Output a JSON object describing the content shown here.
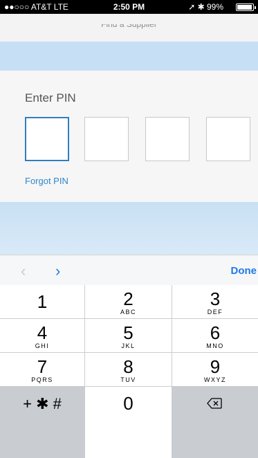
{
  "status_bar": {
    "carrier": "●●○○○ AT&T  LTE",
    "time": "2:50 PM",
    "indicators": "➚ ✱ 99%"
  },
  "header": {
    "ghost_title": "Find a Supplier"
  },
  "pin": {
    "label": "Enter PIN",
    "forgot_link": "Forgot PIN",
    "digit_count": 4
  },
  "toolbar": {
    "prev_icon": "chevron-left-icon",
    "next_icon": "chevron-right-icon",
    "prev_glyph": "‹",
    "next_glyph": "›",
    "done_label": "Done"
  },
  "keypad": {
    "keys": [
      {
        "digit": "1",
        "letters": ""
      },
      {
        "digit": "2",
        "letters": "ABC"
      },
      {
        "digit": "3",
        "letters": "DEF"
      },
      {
        "digit": "4",
        "letters": "GHI"
      },
      {
        "digit": "5",
        "letters": "JKL"
      },
      {
        "digit": "6",
        "letters": "MNO"
      },
      {
        "digit": "7",
        "letters": "PQRS"
      },
      {
        "digit": "8",
        "letters": "TUV"
      },
      {
        "digit": "9",
        "letters": "WXYZ"
      },
      {
        "digit": "+ ✱ #",
        "letters": ""
      },
      {
        "digit": "0",
        "letters": ""
      },
      {
        "digit": "",
        "letters": "",
        "icon": "backspace-icon"
      }
    ]
  },
  "colors": {
    "accent": "#1f7ae6",
    "link": "#2f86c8",
    "band": "#c6dff4"
  }
}
